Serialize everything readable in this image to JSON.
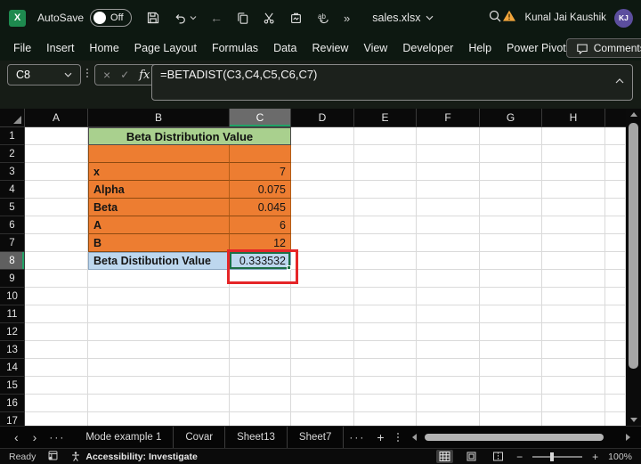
{
  "colors": {
    "excel_green": "#21A366",
    "share_green": "#2EA35F",
    "title_fill": "#A9D08E",
    "body_fill": "#ED7D31",
    "result_fill": "#BDD7EE",
    "annotation_red": "#E52528",
    "selection_green": "#1E6E45",
    "avatar_purple": "#5C4E9E",
    "warning_orange": "#F2A53C"
  },
  "icons": {
    "overflow": "»",
    "back": "←",
    "cancel": "×",
    "enter": "✓",
    "prev": "‹",
    "next": "›",
    "ellipsis": "···",
    "plus": "+",
    "minus": "−",
    "close": "×",
    "minimize": "–"
  },
  "title_bar": {
    "app_initial": "X",
    "autosave_label": "AutoSave",
    "autosave_state": "Off",
    "file_name": "sales.xlsx",
    "user_name": "Kunal Jai Kaushik",
    "user_initials": "KJ"
  },
  "ribbon": {
    "tabs": [
      "File",
      "Insert",
      "Home",
      "Page Layout",
      "Formulas",
      "Data",
      "Review",
      "View",
      "Developer",
      "Help",
      "Power Pivot"
    ],
    "comments_label": "Comments"
  },
  "formula_bar": {
    "name_box_value": "C8",
    "fx_label": "fx",
    "formula": "=BETADIST(C3,C4,C5,C6,C7)"
  },
  "sheet": {
    "column_headers": [
      "A",
      "B",
      "C",
      "D",
      "E",
      "F",
      "G",
      "H"
    ],
    "selected_column": "C",
    "selected_row": "8",
    "selected_cell": "C8",
    "row_headers_top": [
      "1",
      "2"
    ],
    "row_headers_bottom": [
      "9",
      "10",
      "11",
      "12",
      "13",
      "14",
      "15",
      "16",
      "17"
    ],
    "table": {
      "title": "Beta Distribution Value",
      "rows": [
        {
          "row": "3",
          "label": "x",
          "value": "7"
        },
        {
          "row": "4",
          "label": "Alpha",
          "value": "0.075"
        },
        {
          "row": "5",
          "label": "Beta",
          "value": "0.045"
        },
        {
          "row": "6",
          "label": "A",
          "value": "6"
        },
        {
          "row": "7",
          "label": "B",
          "value": "12"
        }
      ],
      "result_row": "8",
      "result_label": "Beta Distibution Value",
      "result_value": "0.333532"
    }
  },
  "sheet_tab_bar": {
    "tabs": [
      "Mode example 1",
      "Covar",
      "Sheet13",
      "Sheet7"
    ]
  },
  "status_bar": {
    "ready_label": "Ready",
    "accessibility_label": "Accessibility: Investigate",
    "zoom_label": "100%"
  }
}
